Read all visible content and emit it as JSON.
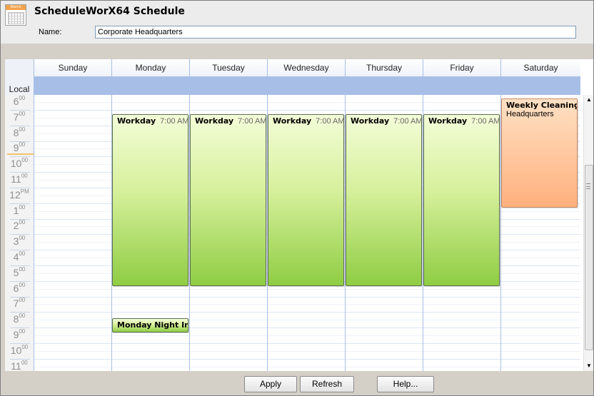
{
  "app": {
    "title": "ScheduleWorX64 Schedule",
    "icon": "calendar-icon",
    "icon_header_text": "March"
  },
  "form": {
    "name_label": "Name:",
    "name_value": "Corporate Headquarters"
  },
  "schedule": {
    "timezone_label": "Local",
    "days": [
      "Sunday",
      "Monday",
      "Tuesday",
      "Wednesday",
      "Thursday",
      "Friday",
      "Saturday"
    ],
    "time_slots": [
      {
        "hour": "6",
        "suffix": "00"
      },
      {
        "hour": "7",
        "suffix": "00"
      },
      {
        "hour": "8",
        "suffix": "00"
      },
      {
        "hour": "9",
        "suffix": "00"
      },
      {
        "hour": "10",
        "suffix": "00"
      },
      {
        "hour": "11",
        "suffix": "00"
      },
      {
        "hour": "12",
        "suffix": "PM"
      },
      {
        "hour": "1",
        "suffix": "00"
      },
      {
        "hour": "2",
        "suffix": "00"
      },
      {
        "hour": "3",
        "suffix": "00"
      },
      {
        "hour": "4",
        "suffix": "00"
      },
      {
        "hour": "5",
        "suffix": "00"
      },
      {
        "hour": "6",
        "suffix": "00"
      },
      {
        "hour": "7",
        "suffix": "00"
      },
      {
        "hour": "8",
        "suffix": "00"
      },
      {
        "hour": "9",
        "suffix": "00"
      },
      {
        "hour": "10",
        "suffix": "00"
      },
      {
        "hour": "11",
        "suffix": "00"
      }
    ],
    "appointments": [
      {
        "day": "Monday",
        "subject": "Workday",
        "time": "7:00 AM -",
        "location": "",
        "color": "#8fcd43"
      },
      {
        "day": "Tuesday",
        "subject": "Workday",
        "time": "7:00 AM -",
        "location": "",
        "color": "#8fcd43"
      },
      {
        "day": "Wednesday",
        "subject": "Workday",
        "time": "7:00 AM -",
        "location": "",
        "color": "#8fcd43"
      },
      {
        "day": "Thursday",
        "subject": "Workday",
        "time": "7:00 AM -",
        "location": "",
        "color": "#8fcd43"
      },
      {
        "day": "Friday",
        "subject": "Workday",
        "time": "7:00 AM -",
        "location": "",
        "color": "#8fcd43"
      },
      {
        "day": "Saturday",
        "subject": "Weekly Cleaning",
        "time": "6",
        "location": "Headquarters",
        "color": "#ffb07d"
      },
      {
        "day": "Monday",
        "subject": "Monday Night Insp",
        "time": "",
        "location": "",
        "color": "#8fcd43"
      }
    ]
  },
  "scrollbar": {
    "up_icon": "scroll-up-arrow-icon",
    "down_icon": "scroll-down-arrow-icon"
  },
  "footer": {
    "apply": "Apply",
    "refresh": "Refresh",
    "help": "Help..."
  }
}
